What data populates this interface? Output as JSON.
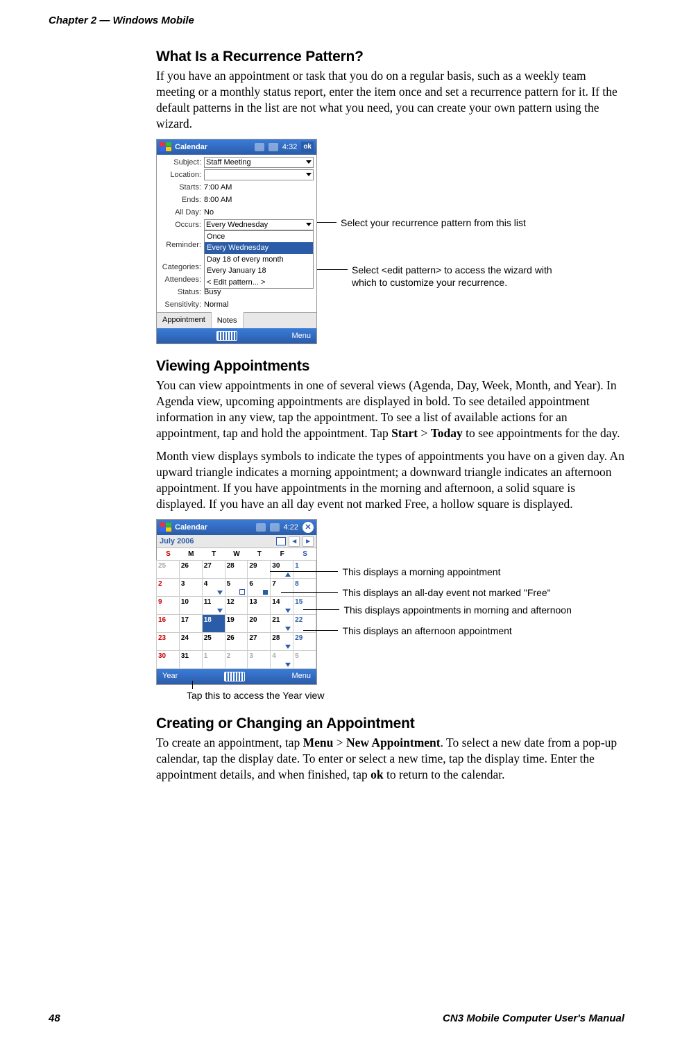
{
  "header": "Chapter 2 — Windows Mobile",
  "footer": {
    "page": "48",
    "manual": "CN3 Mobile Computer User's Manual"
  },
  "s1": {
    "heading": "What Is a Recurrence Pattern?",
    "para": "If you have an appointment or task that you do on a regular basis, such as a weekly team meeting or a monthly status report, enter the item once and set a recurrence pattern for it. If the default patterns in the list are not what you need, you can create your own pattern using the wizard."
  },
  "ss1": {
    "title": "Calendar",
    "time": "4:32",
    "ok": "ok",
    "labels": {
      "subject": "Subject:",
      "location": "Location:",
      "starts": "Starts:",
      "ends": "Ends:",
      "allday": "All Day:",
      "occurs": "Occurs:",
      "reminder": "Reminder:",
      "categories": "Categories:",
      "attendees": "Attendees:",
      "status": "Status:",
      "sensitivity": "Sensitivity:",
      "appointment": "Appointment",
      "notes": "Notes"
    },
    "vals": {
      "subject": "Staff Meeting",
      "location": "",
      "starts": "7:00 AM",
      "ends": "8:00 AM",
      "allday": "No",
      "occurs": "Every Wednesday",
      "status": "Busy",
      "sensitivity": "Normal"
    },
    "dropdown": [
      "Once",
      "Every Wednesday",
      "Day 18 of every month",
      "Every January 18",
      "< Edit pattern... >"
    ],
    "menu": "Menu"
  },
  "co1": {
    "a": "Select your recurrence pattern from this list",
    "b": "Select <edit pattern> to access the wizard with which to customize your recurrence."
  },
  "s2": {
    "heading": "Viewing Appointments",
    "p1a": "You can view appointments in one of several views (Agenda, Day, Week, Month, and Year). In Agenda view, upcoming appointments are displayed in bold. To see detailed appointment information in any view, tap the appointment. To see a list of available actions for an appointment, tap and hold the appointment. Tap ",
    "p1b": "Start",
    "p1c": " > ",
    "p1d": "Today",
    "p1e": " to see appointments for the day.",
    "p2": "Month view displays symbols to indicate the types of appointments you have on a given day. An upward triangle indicates a morning appointment; a downward triangle indicates an afternoon appointment. If you have appointments in the morning and afternoon, a solid square is displayed. If you have an all day event not marked Free, a hollow square is displayed."
  },
  "ss2": {
    "title": "Calendar",
    "time": "4:22",
    "month": "July 2006",
    "dows": [
      "S",
      "M",
      "T",
      "W",
      "T",
      "F",
      "S"
    ],
    "year": "Year",
    "menu": "Menu"
  },
  "co2": {
    "a": "This displays a morning appointment",
    "b": "This displays an all-day event not marked \"Free\"",
    "c": "This displays appointments in morning and afternoon",
    "d": "This displays an afternoon appointment",
    "below": "Tap this to access the Year view"
  },
  "s3": {
    "heading": "Creating or Changing an Appointment",
    "p_a": "To create an appointment, tap ",
    "p_b": "Menu",
    "p_c": " > ",
    "p_d": "New Appointment",
    "p_e": ". To select a new date from a pop-up calendar, tap the display date. To enter or select a new time, tap the display time. Enter the appointment details, and when finished, tap ",
    "p_f": "ok",
    "p_g": " to return to the calendar."
  }
}
